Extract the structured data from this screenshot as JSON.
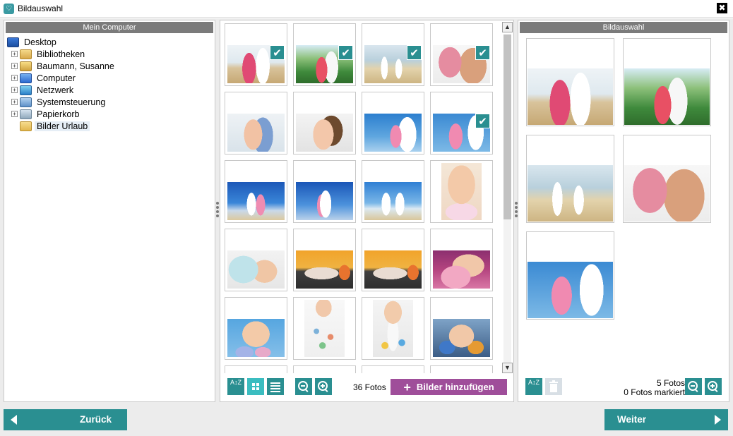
{
  "window": {
    "title": "Bildauswahl",
    "icon": "app-logo-icon",
    "close_glyph": "✖"
  },
  "left_panel": {
    "header": "Mein Computer",
    "tree": [
      {
        "label": "Desktop",
        "icon": "desktop-icon",
        "level": 0,
        "expander": ""
      },
      {
        "label": "Bibliotheken",
        "icon": "libraries-icon",
        "level": 1,
        "expander": "+"
      },
      {
        "label": "Baumann, Susanne",
        "icon": "user-folder-icon",
        "level": 1,
        "expander": "+"
      },
      {
        "label": "Computer",
        "icon": "computer-icon",
        "level": 1,
        "expander": "+"
      },
      {
        "label": "Netzwerk",
        "icon": "network-icon",
        "level": 1,
        "expander": "+"
      },
      {
        "label": "Systemsteuerung",
        "icon": "control-panel-icon",
        "level": 1,
        "expander": "+"
      },
      {
        "label": "Papierkorb",
        "icon": "recycle-bin-icon",
        "level": 1,
        "expander": "+"
      },
      {
        "label": "Bilder Urlaub",
        "icon": "folder-icon",
        "level": 1,
        "expander": "",
        "selected": true
      }
    ]
  },
  "middle_panel": {
    "photo_count": "36 Fotos",
    "add_button": "Bilder hinzufügen",
    "add_icon": "+",
    "sort_icon": "A↕Z",
    "checkmark": "✔",
    "tools": {
      "sort": "sort-az-icon",
      "grid": "grid-view-icon",
      "list": "list-view-icon",
      "zoom_out": "zoom-out-icon",
      "zoom_in": "zoom-in-icon"
    },
    "thumbnails": [
      {
        "style": "beach-couple",
        "checked": true
      },
      {
        "style": "palm",
        "checked": true
      },
      {
        "style": "shore",
        "checked": true
      },
      {
        "style": "kiss",
        "checked": true
      },
      {
        "style": "hug",
        "checked": false
      },
      {
        "style": "hug2",
        "checked": false
      },
      {
        "style": "sky-point",
        "checked": false
      },
      {
        "style": "sky-girl",
        "checked": true
      },
      {
        "style": "sky-fam",
        "checked": false
      },
      {
        "style": "sky-fam2",
        "checked": false
      },
      {
        "style": "sky-fam3",
        "checked": false
      },
      {
        "style": "blow",
        "checked": false,
        "portrait": true
      },
      {
        "style": "house",
        "checked": false
      },
      {
        "style": "sleep",
        "checked": false
      },
      {
        "style": "sleep",
        "checked": false
      },
      {
        "style": "pink",
        "checked": false
      },
      {
        "style": "abc",
        "checked": false
      },
      {
        "style": "hands",
        "checked": false,
        "portrait": true
      },
      {
        "style": "paint",
        "checked": false,
        "portrait": true
      },
      {
        "style": "colorhands",
        "checked": false
      }
    ]
  },
  "right_panel": {
    "header": "Bildauswahl",
    "count": "5 Fotos",
    "marked": "0 Fotos markiert",
    "sort_icon": "A↕Z",
    "tools": {
      "sort": "sort-az-icon",
      "delete": "trash-icon",
      "zoom_out": "zoom-out-icon",
      "zoom_in": "zoom-in-icon"
    },
    "selected": [
      {
        "style": "beach-couple"
      },
      {
        "style": "palm"
      },
      {
        "style": "shore"
      },
      {
        "style": "kiss"
      },
      {
        "style": "sky-girl"
      }
    ]
  },
  "navigation": {
    "back": "Zurück",
    "next": "Weiter"
  },
  "colors": {
    "accent": "#2a8f91",
    "accent_light": "#3bbdc0",
    "add_button": "#9f4e9a",
    "header_gray": "#7b7b7b"
  }
}
